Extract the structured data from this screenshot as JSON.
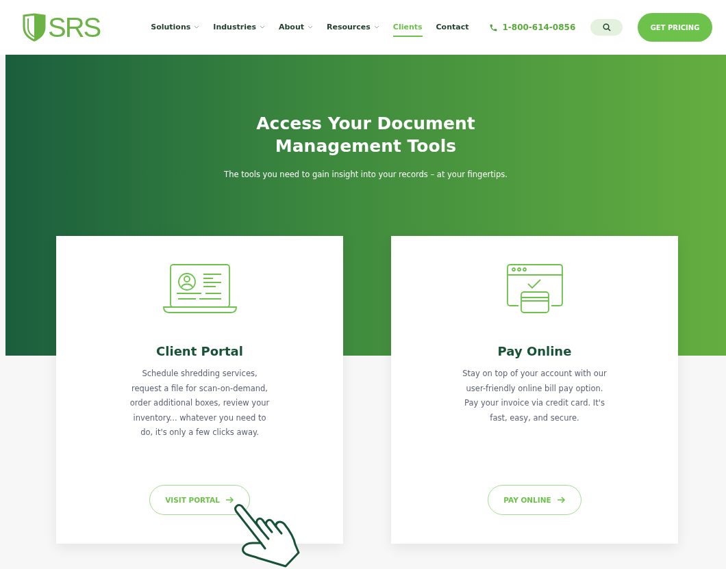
{
  "header": {
    "logo_text": "SRS",
    "nav": [
      {
        "label": "Solutions",
        "dropdown": true,
        "selected": false
      },
      {
        "label": "Industries",
        "dropdown": true,
        "selected": false
      },
      {
        "label": "About",
        "dropdown": true,
        "selected": false
      },
      {
        "label": "Resources",
        "dropdown": true,
        "selected": false
      },
      {
        "label": "Clients",
        "dropdown": false,
        "selected": true
      },
      {
        "label": "Contact",
        "dropdown": false,
        "selected": false
      }
    ],
    "phone": "1-800-614-0856",
    "cta": "GET PRICING"
  },
  "hero": {
    "title": "Access Your Document Management Tools",
    "subtitle": "The tools you need to gain insight into your records – at your fingertips."
  },
  "cards": [
    {
      "kind": "laptop",
      "title": "Client Portal",
      "text": "Schedule shredding services, request a file for scan-on-demand, order additional boxes, review your inventory...  whatever you need to do, it's only a few clicks away.",
      "button": "VISIT PORTAL"
    },
    {
      "kind": "payment",
      "title": "Pay Online",
      "text": "Stay on top of your account with our user-friendly online bill pay option.  Pay your invoice via credit card. It's fast, easy, and secure.",
      "button": "PAY ONLINE"
    }
  ]
}
